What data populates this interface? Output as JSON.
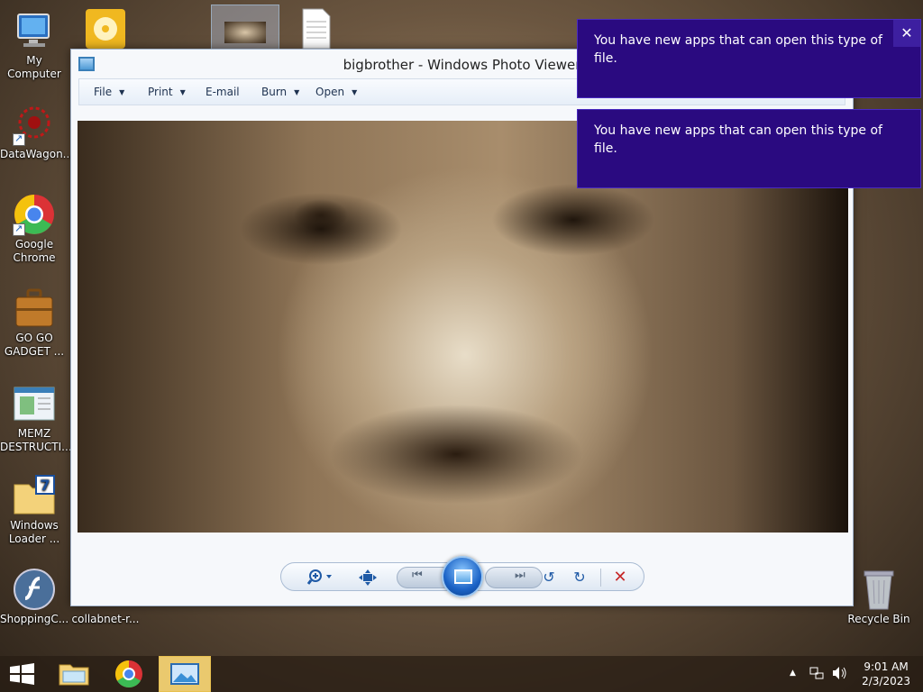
{
  "desktop": {
    "icons": [
      {
        "label": "My Computer"
      },
      {
        "label": "DataWagon..."
      },
      {
        "label": "Google Chrome"
      },
      {
        "label": "GO GO GADGET ..."
      },
      {
        "label": "MEMZ DESTRUCTI..."
      },
      {
        "label": "Windows Loader ..."
      },
      {
        "label": "ShoppingC..."
      },
      {
        "label": "collabnet-r..."
      },
      {
        "label": "Recycle Bin"
      }
    ]
  },
  "viewer": {
    "title": "bigbrother - Windows Photo Viewer",
    "menu": {
      "file": "File",
      "print": "Print",
      "email": "E-mail",
      "burn": "Burn",
      "open": "Open"
    }
  },
  "notifications": [
    {
      "text": "You have new apps that can open this type of file."
    },
    {
      "text": "You have new apps that can open this type of file."
    }
  ],
  "toast_close": "✕",
  "taskbar": {
    "time": "9:01 AM",
    "date": "2/3/2023"
  },
  "colors": {
    "toast_bg": "#2a0a80",
    "accent_blue": "#1f5aa6",
    "delete_red": "#c62828"
  }
}
